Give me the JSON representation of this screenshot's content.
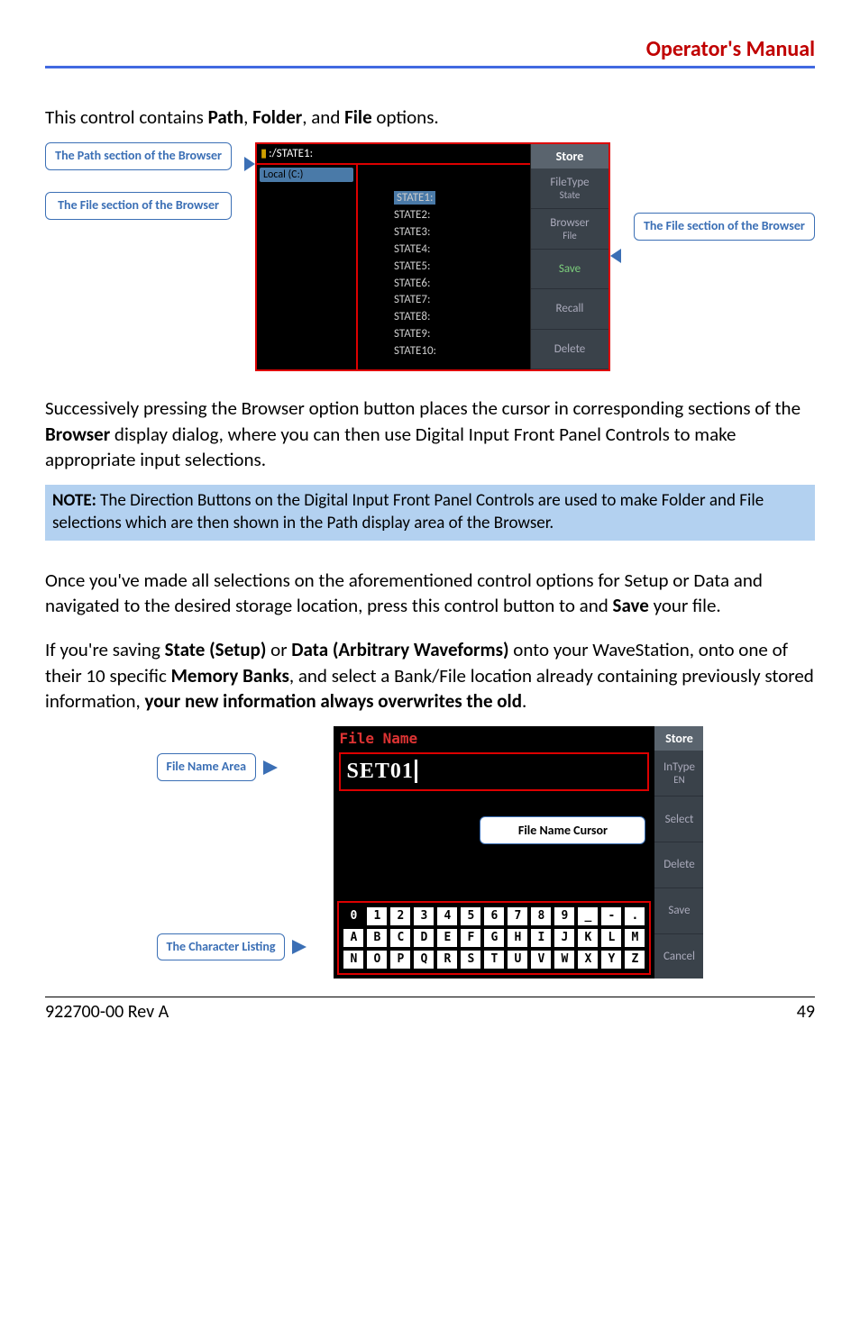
{
  "header": {
    "title": "Operator's Manual"
  },
  "p1": {
    "pre": "This control contains ",
    "b1": "Path",
    "mid1": ", ",
    "b2": "Folder",
    "mid2": ", and ",
    "b3": "File",
    "post": " options."
  },
  "fig1": {
    "callout_path": "The Path section of the Browser",
    "callout_file": "The File section of the Browser",
    "callout_filesave": "The File section of the Browser",
    "path_text": ":/STATE1:",
    "local_label": "Local (C:)",
    "states": [
      "STATE1:",
      "STATE2:",
      "STATE3:",
      "STATE4:",
      "STATE5:",
      "STATE6:",
      "STATE7:",
      "STATE8:",
      "STATE9:",
      "STATE10:"
    ],
    "sidebar": {
      "title": "Store",
      "filetype": "FileType",
      "filetype_sub": "State",
      "browser": "Browser",
      "browser_sub": "File",
      "save": "Save",
      "recall": "Recall",
      "delete": "Delete"
    }
  },
  "p2": {
    "pre": "Successively pressing the Browser option button places the cursor in corresponding sections of the ",
    "b1": "Browser",
    "post": " display dialog, where you can then use Digital Input Front Panel Controls to make appropriate input selections."
  },
  "note": {
    "b": "NOTE:",
    "text": " The Direction Buttons on the Digital Input Front Panel Controls are used to make Folder and File selections which are then shown in the Path display area of the Browser."
  },
  "p3": {
    "pre": "Once you've made all selections on the aforementioned control options for Setup or Data and navigated to the desired storage location, press this control button to and ",
    "b1": "Save",
    "post": " your file."
  },
  "p4": {
    "pre": "If you're saving ",
    "b1": "State (Setup)",
    "mid1": " or ",
    "b2": "Data (Arbitrary Waveforms)",
    "mid2": " onto your WaveStation, onto one of their 10 specific ",
    "b3": "Memory Banks",
    "mid3": ", and select a Bank/File location already containing previously stored information, ",
    "b4": "your new information always overwrites the old",
    "post": "."
  },
  "fig2": {
    "callout_namearea": "File Name Area",
    "callout_charlist": "The Character Listing",
    "callout_cursor": "File Name Cursor",
    "file_name_label": "File Name",
    "filename": "SET01",
    "row1": [
      "0",
      "1",
      "2",
      "3",
      "4",
      "5",
      "6",
      "7",
      "8",
      "9",
      "_",
      "-",
      "."
    ],
    "row2": [
      "A",
      "B",
      "C",
      "D",
      "E",
      "F",
      "G",
      "H",
      "I",
      "J",
      "K",
      "L",
      "M"
    ],
    "row3": [
      "N",
      "O",
      "P",
      "Q",
      "R",
      "S",
      "T",
      "U",
      "V",
      "W",
      "X",
      "Y",
      "Z"
    ],
    "sidebar": {
      "title": "Store",
      "intype": "InType",
      "intype_sub": "EN",
      "select": "Select",
      "delete": "Delete",
      "save": "Save",
      "cancel": "Cancel"
    }
  },
  "footer": {
    "left": "922700-00 Rev A",
    "right": "49"
  }
}
